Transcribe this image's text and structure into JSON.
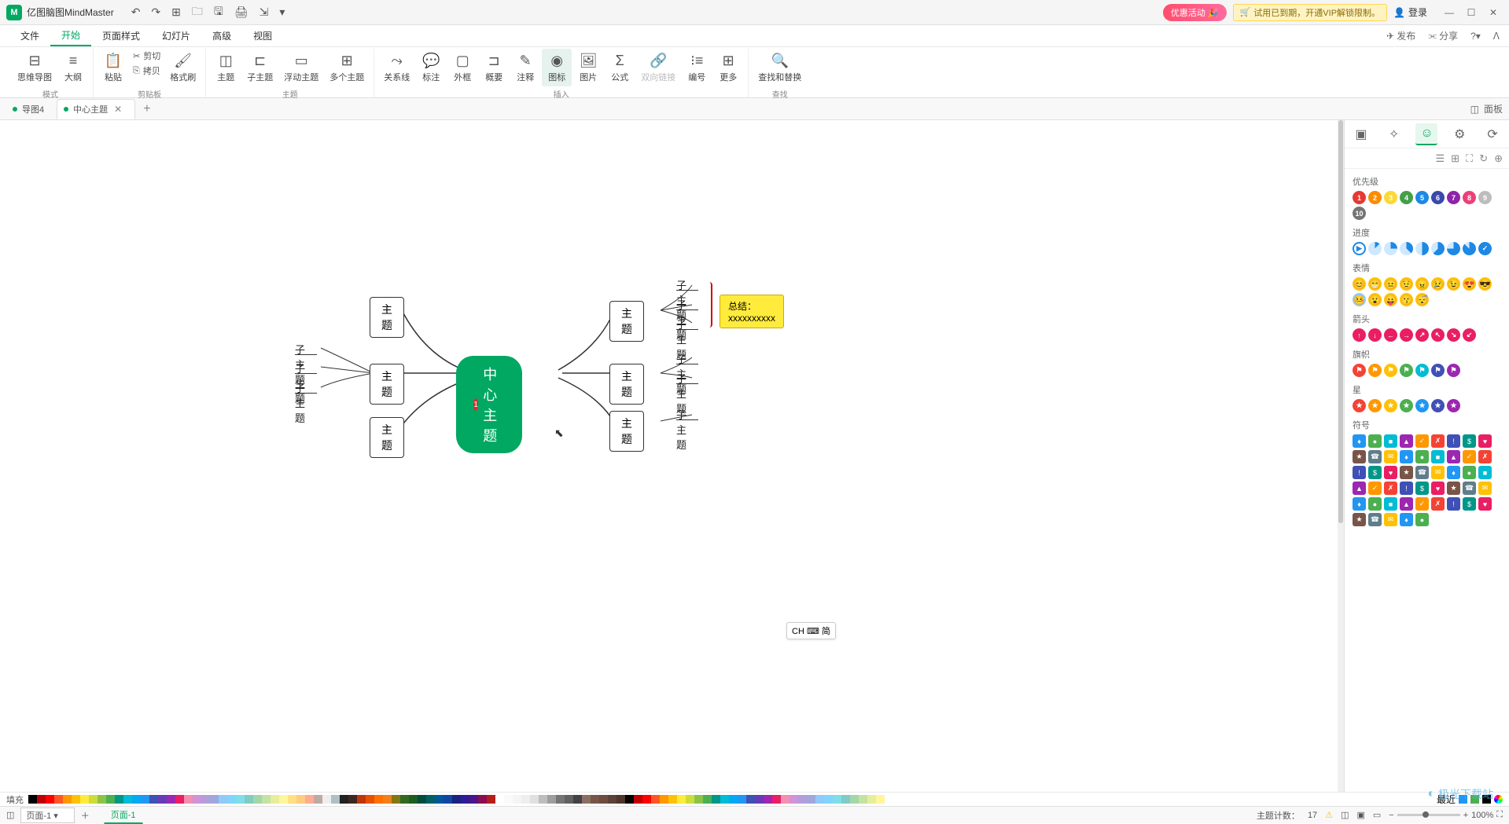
{
  "app": {
    "name": "亿图脑图MindMaster",
    "logo_letter": "M"
  },
  "title_right": {
    "promo": "优惠活动",
    "trial": "试用已到期，开通VIP解锁限制。",
    "login": "登录"
  },
  "menu": {
    "items": [
      "文件",
      "开始",
      "页面样式",
      "幻灯片",
      "高级",
      "视图"
    ],
    "active_index": 1,
    "publish": "发布",
    "share": "分享"
  },
  "ribbon": {
    "mode": {
      "items": [
        "思维导图",
        "大纲"
      ],
      "label": "模式"
    },
    "clipboard": {
      "paste": "粘贴",
      "cut": "剪切",
      "copy": "拷贝",
      "format_painter": "格式刷",
      "label": "剪贴板"
    },
    "topic": {
      "items": [
        "主题",
        "子主题",
        "浮动主题",
        "多个主题"
      ],
      "label": "主题"
    },
    "relation": "关系线",
    "annotation": "标注",
    "callout": "外框",
    "summary": "概要",
    "note": "注释",
    "icon": "图标",
    "image": "图片",
    "formula": "公式",
    "hyperlink": "双向链接",
    "number": "编号",
    "more": "更多",
    "find_replace": "查找和替换",
    "insert_label": "插入",
    "find_label": "查找"
  },
  "tabs": {
    "items": [
      "导图4",
      "中心主题"
    ],
    "active_index": 1,
    "panel_toggle": "面板"
  },
  "mindmap": {
    "central": "中心主题",
    "central_badge": "1",
    "branch": "主题",
    "leaf": "子主题",
    "summary": "总结：xxxxxxxxxx"
  },
  "panel": {
    "sections": {
      "priority": "优先级",
      "progress": "进度",
      "emotion": "表情",
      "arrow": "箭头",
      "flag": "旗帜",
      "star": "星",
      "symbol": "符号"
    }
  },
  "color_bar": {
    "fill_label": "填充",
    "recent_label": "最近"
  },
  "status": {
    "page_selector": "页面-1",
    "page_tab": "页面-1",
    "ime": "CH ⌨ 简",
    "topic_count_label": "主题计数：",
    "topic_count": "17",
    "zoom": "100%"
  },
  "watermark": "极光下载站"
}
